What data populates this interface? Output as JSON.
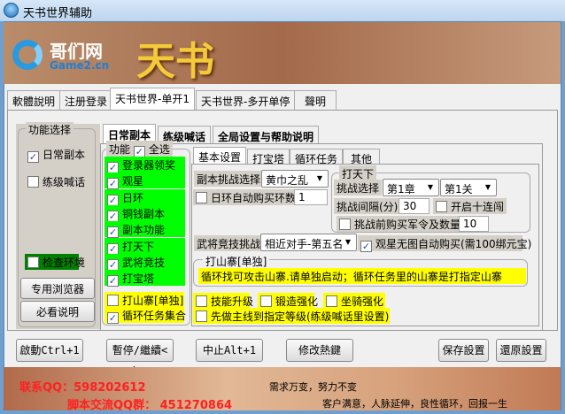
{
  "window": {
    "title": "天书世界辅助"
  },
  "banner": {
    "logo_cn": "哥们网",
    "logo_en": "Game2.cn",
    "game_logo": "天书"
  },
  "main_tabs": [
    "軟體說明",
    "注册登录",
    "天书世界-单开1",
    "天书世界-多开单停",
    "聲明"
  ],
  "left_group": {
    "title": "功能选择",
    "items": [
      {
        "label": "日常副本",
        "checked": true
      },
      {
        "label": "练级喊话",
        "checked": false
      },
      {
        "label": "检查环境",
        "checked": false
      }
    ],
    "buttons": [
      "专用浏览器",
      "必看说明"
    ]
  },
  "inner_tabs": [
    "日常副本",
    "练级喊话",
    "全局设置与帮助说明"
  ],
  "features": {
    "title": "功能",
    "select_all": "全选",
    "items": [
      {
        "label": "登录器领奖",
        "checked": true
      },
      {
        "label": "观星",
        "checked": true
      },
      {
        "label": "日环",
        "checked": true
      },
      {
        "label": "铜钱副本",
        "checked": true
      },
      {
        "label": "副本功能",
        "checked": true
      },
      {
        "label": "打天下",
        "checked": true
      },
      {
        "label": "武将竞技",
        "checked": true
      },
      {
        "label": "打宝塔",
        "checked": true
      }
    ],
    "extra": [
      {
        "label": "打山寨[单独]",
        "checked": false
      },
      {
        "label": "循环任务集合",
        "checked": true
      }
    ]
  },
  "sub_tabs": [
    "基本设置",
    "打宝塔",
    "循环任务",
    "其他"
  ],
  "basic": {
    "dungeon_label": "副本挑战选择",
    "dungeon_value": "黄巾之乱",
    "daily_buy_label": "日环自动购买环数",
    "daily_buy_value": "1",
    "conquer": {
      "title": "打天下",
      "challenge_label": "挑战选择",
      "chapter": "第1章",
      "stage": "第1关",
      "interval_label": "挑战间隔(分)",
      "interval_value": "30",
      "ten_label": "开启十连闯",
      "buy_label": "挑战前购买军令及数量",
      "buy_value": "10"
    },
    "arena_label": "武将竞技挑战",
    "arena_value": "相近对手-第五名",
    "star_buy_label": "观星无图自动购买(需100绑元宝)",
    "bandit": {
      "title": "打山寨[单独]",
      "note": "循环找可攻击山寨.请单独启动；循环任务里的山寨是打指定山寨"
    },
    "options": [
      {
        "label": "技能升级",
        "checked": false
      },
      {
        "label": "锻造强化",
        "checked": false
      },
      {
        "label": "坐骑强化",
        "checked": false
      }
    ],
    "mainline_label": "先做主线到指定等级(练级喊话里设置)"
  },
  "buttons": {
    "start": "啟動Ctrl+1",
    "pause": "暫停/繼續<無>",
    "stop": "中止Alt+1",
    "hotkey": "修改熱鍵",
    "save": "保存設置",
    "restore": "還原設置"
  },
  "footer": {
    "qq": "联系QQ：598202612",
    "group": "脚本交流QQ群： 451270864",
    "slogan1": "需求万变，努力不变",
    "slogan2": "客户满意，人脉延伸，良性循环，回报一生"
  }
}
